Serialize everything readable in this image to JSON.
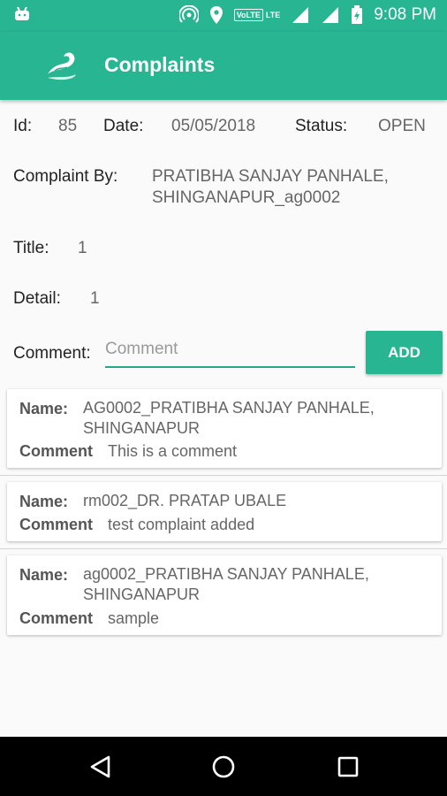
{
  "status_bar": {
    "time": "9:08 PM",
    "network_badge": "VoLTE",
    "lte": "LTE"
  },
  "app_bar": {
    "title": "Complaints"
  },
  "details": {
    "id_label": "Id:",
    "id_value": "85",
    "date_label": "Date:",
    "date_value": "05/05/2018",
    "status_label": "Status:",
    "status_value": "OPEN",
    "by_label": "Complaint By:",
    "by_value_line1": "PRATIBHA SANJAY PANHALE,",
    "by_value_line2": "SHINGANAPUR_ag0002",
    "title_label": "Title:",
    "title_value": "1",
    "detail_label": "Detail:",
    "detail_value": "1"
  },
  "comment_form": {
    "label": "Comment:",
    "placeholder": "Comment",
    "value": "",
    "add_label": "ADD"
  },
  "comments": [
    {
      "name_label": "Name:",
      "name_line1": "AG0002_PRATIBHA SANJAY PANHALE,",
      "name_line2": "SHINGANAPUR",
      "comment_label": "Comment",
      "comment": "This is a comment"
    },
    {
      "name_label": "Name:",
      "name_line1": "rm002_DR. PRATAP UBALE",
      "name_line2": "",
      "comment_label": "Comment",
      "comment": "test complaint added"
    },
    {
      "name_label": "Name:",
      "name_line1": "ag0002_PRATIBHA SANJAY PANHALE,",
      "name_line2": "SHINGANAPUR",
      "comment_label": "Comment",
      "comment": "sample"
    }
  ],
  "colors": {
    "accent": "#27b592",
    "nav_bar": "#000000"
  }
}
